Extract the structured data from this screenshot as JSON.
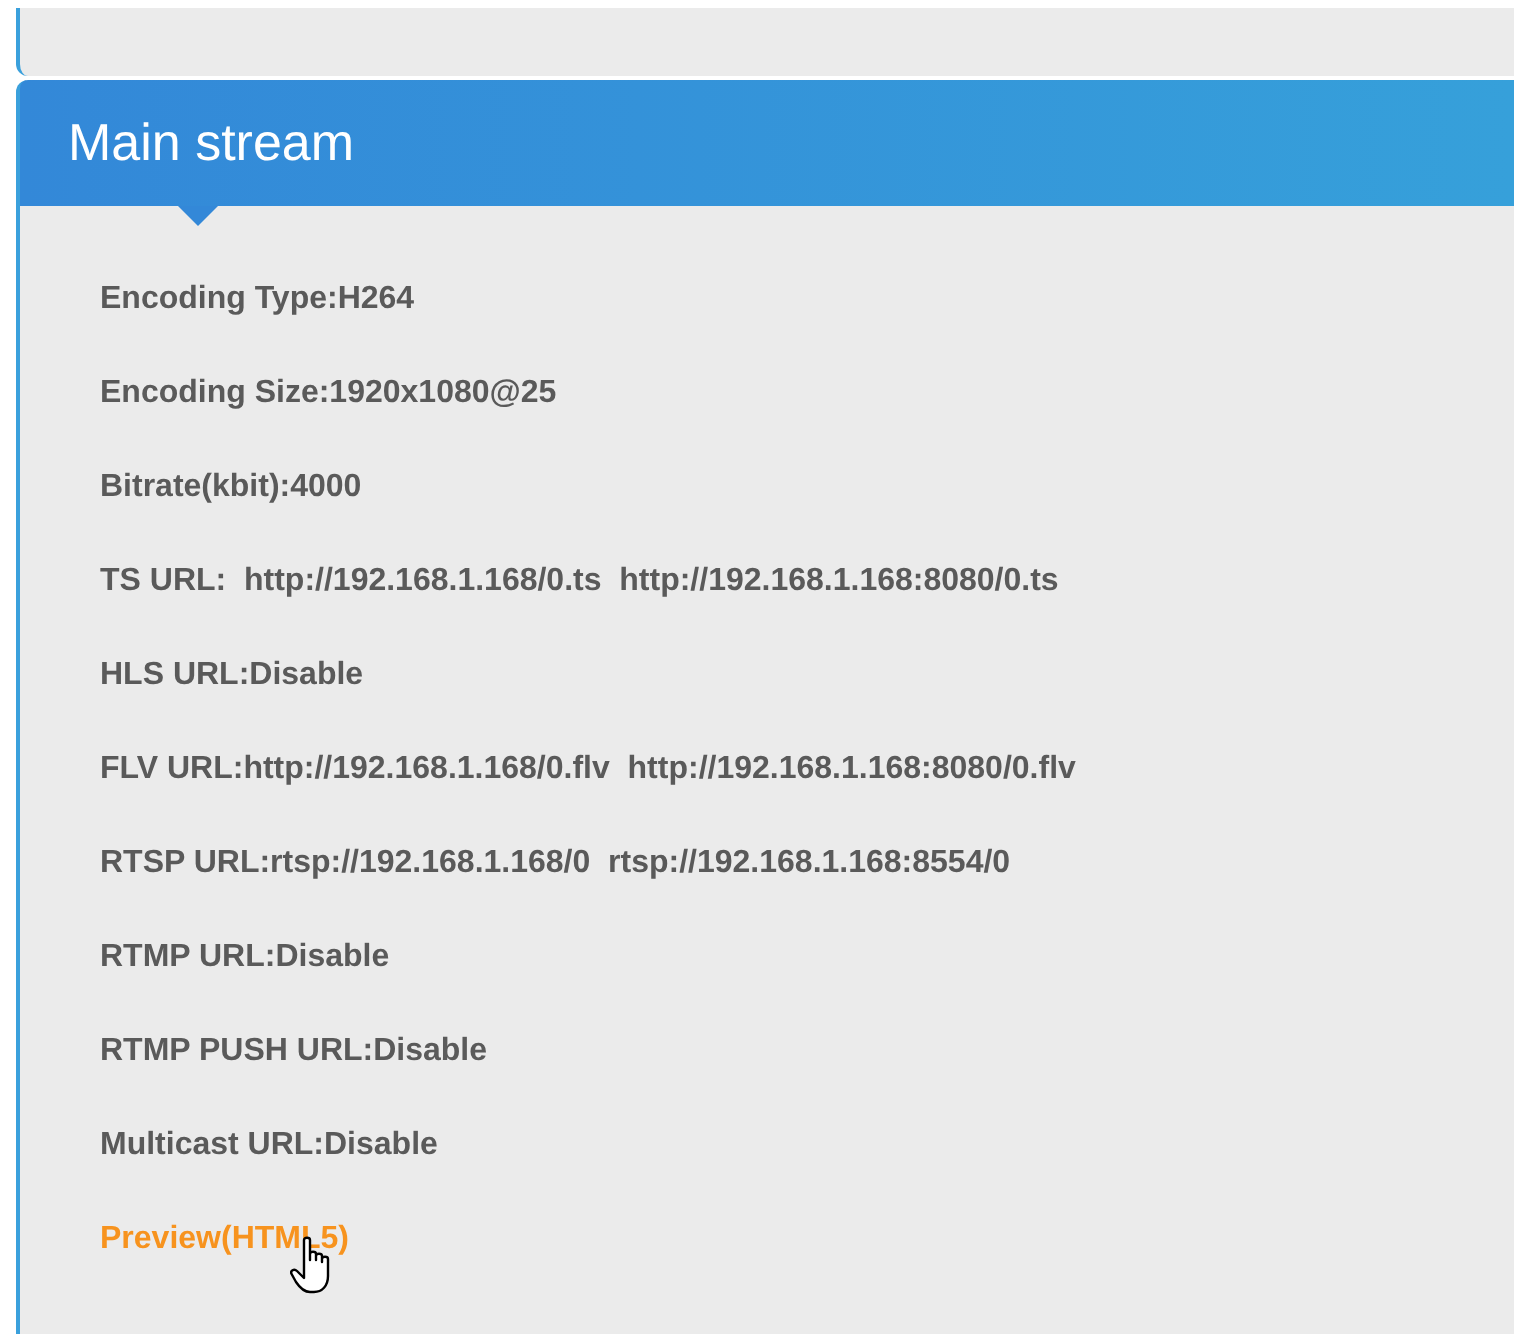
{
  "panel": {
    "title": "Main stream",
    "rows": [
      {
        "kind": "info",
        "text": "Encoding Type:H264"
      },
      {
        "kind": "info",
        "text": "Encoding Size:1920x1080@25"
      },
      {
        "kind": "info",
        "text": "Bitrate(kbit):4000"
      },
      {
        "kind": "info",
        "text": "TS URL:  http://192.168.1.168/0.ts  http://192.168.1.168:8080/0.ts"
      },
      {
        "kind": "info",
        "text": "HLS URL:Disable"
      },
      {
        "kind": "info",
        "text": "FLV URL:http://192.168.1.168/0.flv  http://192.168.1.168:8080/0.flv"
      },
      {
        "kind": "info",
        "text": "RTSP URL:rtsp://192.168.1.168/0  rtsp://192.168.1.168:8554/0"
      },
      {
        "kind": "info",
        "text": "RTMP URL:Disable"
      },
      {
        "kind": "info",
        "text": "RTMP PUSH URL:Disable"
      },
      {
        "kind": "info",
        "text": "Multicast URL:Disable"
      },
      {
        "kind": "link",
        "text": "Preview(HTML5)"
      }
    ]
  }
}
